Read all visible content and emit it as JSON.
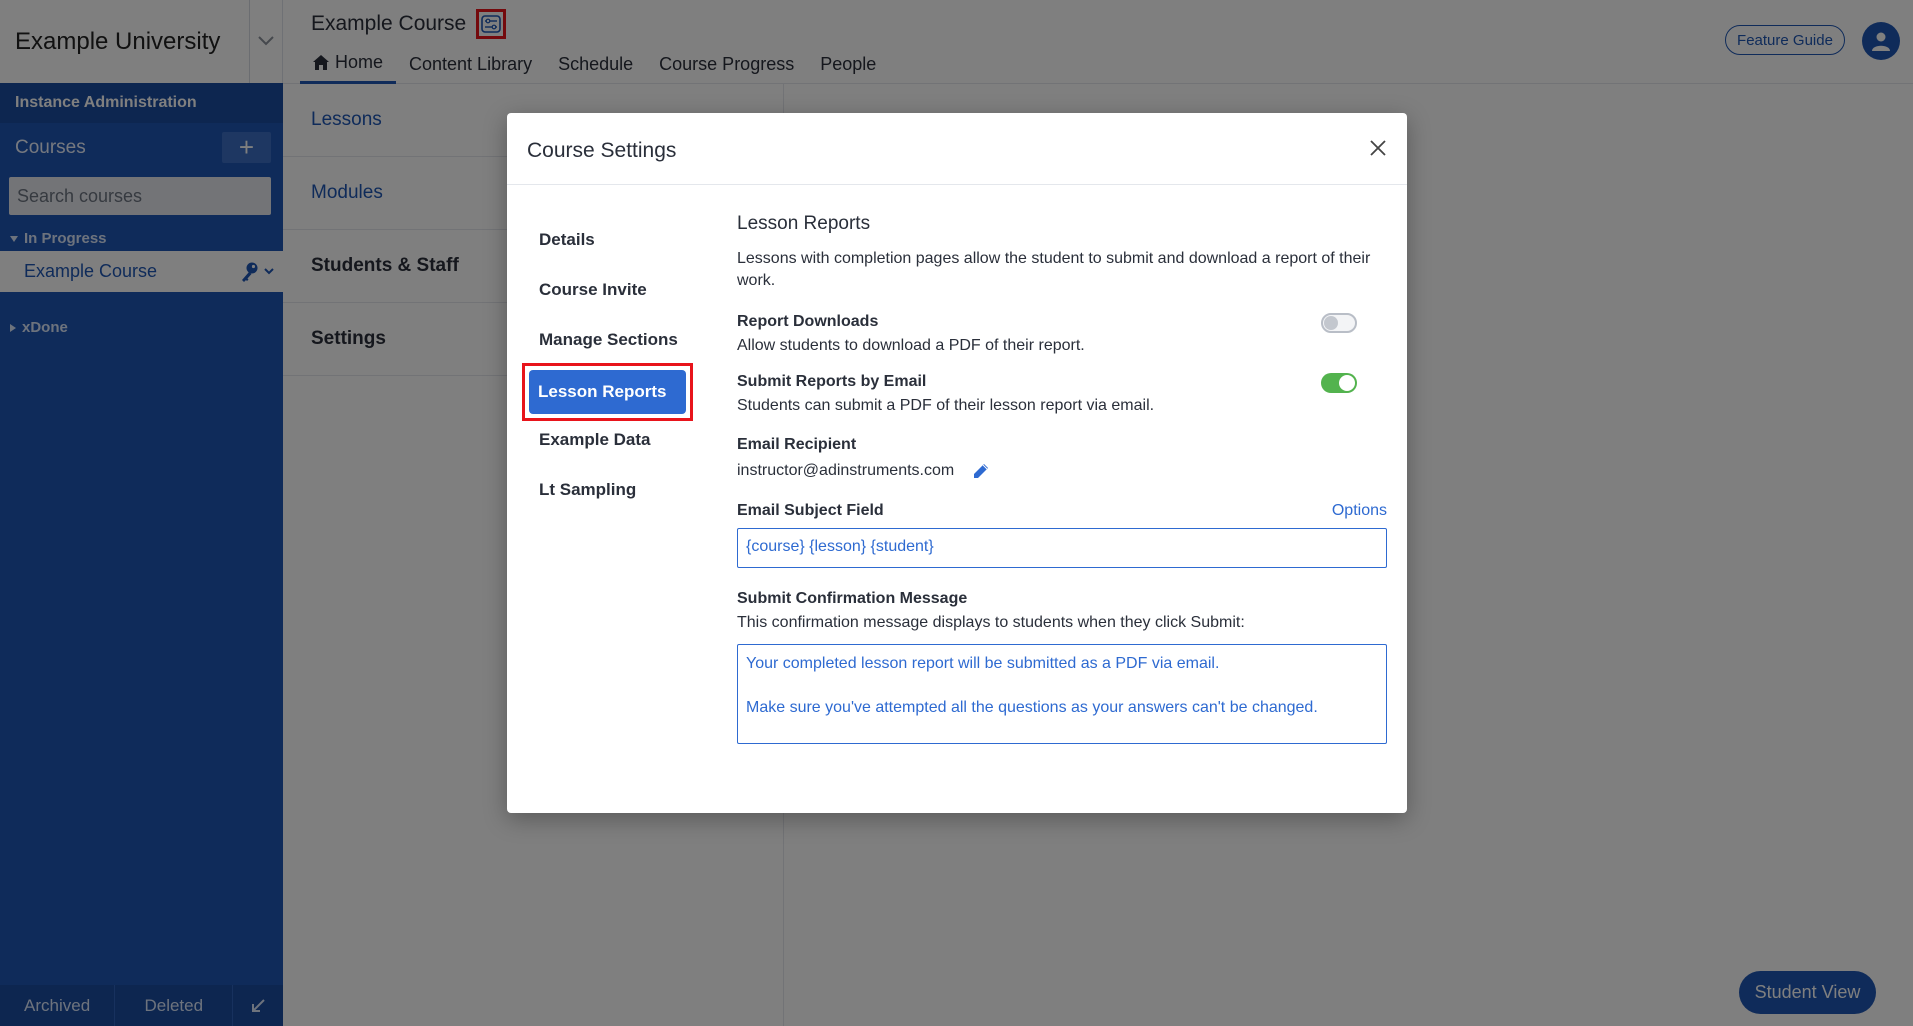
{
  "sidebar": {
    "brand": "Example University",
    "instance_admin": "Instance Administration",
    "courses_label": "Courses",
    "add_symbol": "+",
    "search_placeholder": "Search courses",
    "groups": [
      {
        "label": "In Progress",
        "expanded": true
      },
      {
        "label": "xDone",
        "expanded": false
      }
    ],
    "course_item": "Example Course",
    "bottom": {
      "archived": "Archived",
      "deleted": "Deleted"
    }
  },
  "header": {
    "course_title": "Example Course",
    "nav": [
      "Home",
      "Content Library",
      "Schedule",
      "Course Progress",
      "People"
    ],
    "feature_guide": "Feature Guide"
  },
  "left_list": [
    "Lessons",
    "Modules",
    "Students & Staff",
    "Settings"
  ],
  "student_view": "Student View",
  "modal": {
    "title": "Course Settings",
    "nav": [
      "Details",
      "Course Invite",
      "Manage Sections",
      "Lesson Reports",
      "Example Data",
      "Lt Sampling"
    ],
    "active_nav": "Lesson Reports",
    "content": {
      "title": "Lesson Reports",
      "description": "Lessons with completion pages allow the student to submit and download a report of their work.",
      "report_downloads": {
        "label": "Report Downloads",
        "help": "Allow students to download a PDF of their report.",
        "enabled": false
      },
      "submit_email": {
        "label": "Submit Reports by Email",
        "help": "Students can submit a PDF of their lesson report via email.",
        "enabled": true
      },
      "email_recipient": {
        "label": "Email Recipient",
        "value": "instructor@adinstruments.com"
      },
      "email_subject": {
        "label": "Email Subject Field",
        "options": "Options",
        "value": "{course} {lesson} {student}"
      },
      "confirmation": {
        "label": "Submit Confirmation Message",
        "help": "This confirmation message displays to students when they click Submit:",
        "line1": "Your completed lesson report will be submitted as a PDF via email.",
        "line2": "Make sure you've attempted all the questions as your answers can't be changed."
      }
    }
  },
  "colors": {
    "primary": "#1f57b4",
    "highlight": "#e8141b",
    "toggle_on": "#53b34e"
  }
}
